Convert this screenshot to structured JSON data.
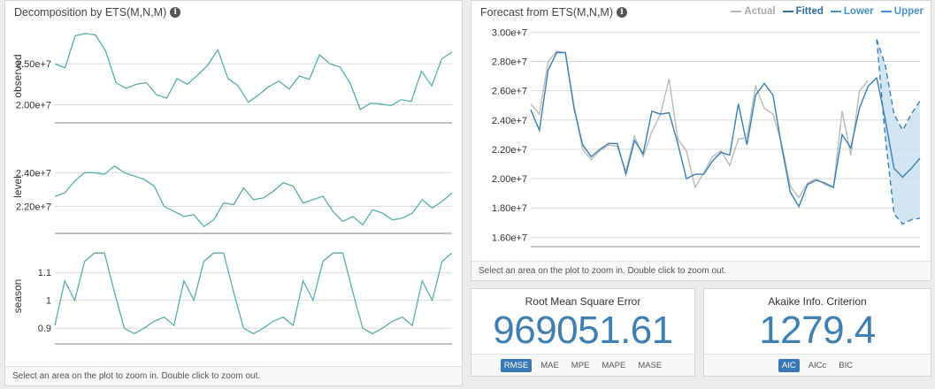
{
  "left_panel": {
    "title": "Decomposition by ETS(M,N,M)",
    "hint": "Select an area on the plot to zoom in. Double click to zoom out."
  },
  "right_panel": {
    "title": "Forecast from ETS(M,N,M)",
    "hint": "Select an area on the plot to zoom in. Double click to zoom out."
  },
  "rmse_card": {
    "title": "Root Mean Square Error",
    "value": "969051.61",
    "tabs": [
      {
        "label": "RMSE",
        "active": true
      },
      {
        "label": "MAE",
        "active": false
      },
      {
        "label": "MPE",
        "active": false
      },
      {
        "label": "MAPE",
        "active": false
      },
      {
        "label": "MASE",
        "active": false
      }
    ]
  },
  "aic_card": {
    "title": "Akaike Info. Criterion",
    "value": "1279.4",
    "tabs": [
      {
        "label": "AIC",
        "active": true
      },
      {
        "label": "AICc",
        "active": false
      },
      {
        "label": "BIC",
        "active": false
      }
    ]
  },
  "colors": {
    "teal": "#5aaea9",
    "actual": "#bbbbbb",
    "fitted": "#3a7fb5",
    "band": "#c5dff0",
    "bound": "#3a7fb5"
  },
  "chart_data": [
    {
      "type": "line",
      "title": "Decomposition by ETS(M,N,M)",
      "ylabel": "observed",
      "ytick_labels": [
        "2.50e+7",
        "2.00e+7"
      ],
      "ytick_values": [
        25000000,
        20000000
      ],
      "ylim": [
        18000000,
        29000000
      ],
      "x": [
        1,
        2,
        3,
        4,
        5,
        6,
        7,
        8,
        9,
        10,
        11,
        12,
        13,
        14,
        15,
        16,
        17,
        18,
        19,
        20,
        21,
        22,
        23,
        24,
        25,
        26,
        27,
        28,
        29,
        30,
        31,
        32,
        33,
        34,
        35,
        36,
        37,
        38,
        39,
        40,
        41,
        42,
        43,
        44,
        45,
        46,
        47,
        48
      ],
      "values": [
        25000000,
        24500000,
        28400000,
        28700000,
        28500000,
        26500000,
        22700000,
        22000000,
        22500000,
        22700000,
        21200000,
        20800000,
        23200000,
        22500000,
        23600000,
        24800000,
        26700000,
        23200000,
        22300000,
        20300000,
        21200000,
        22200000,
        22900000,
        21900000,
        23500000,
        23100000,
        26100000,
        25000000,
        24600000,
        22600000,
        19400000,
        20200000,
        20100000,
        19900000,
        20600000,
        20400000,
        24100000,
        22300000,
        25600000,
        26400000
      ]
    },
    {
      "type": "line",
      "ylabel": "level",
      "ytick_labels": [
        "2.40e+7",
        "2.20e+7"
      ],
      "ytick_values": [
        24000000,
        22000000
      ],
      "ylim": [
        20500000,
        25800000
      ],
      "values": [
        22600000,
        22800000,
        23500000,
        24000000,
        24000000,
        23900000,
        24400000,
        24000000,
        23800000,
        23600000,
        23200000,
        22000000,
        21700000,
        21400000,
        21500000,
        20800000,
        21200000,
        22200000,
        22100000,
        23100000,
        22400000,
        22500000,
        22900000,
        23400000,
        23200000,
        22200000,
        22400000,
        22600000,
        21700000,
        21100000,
        21400000,
        20900000,
        21800000,
        21600000,
        21200000,
        21300000,
        21600000,
        22400000,
        21900000,
        22300000,
        22800000
      ]
    },
    {
      "type": "line",
      "ylabel": "season",
      "ytick_labels": [
        "1.1",
        "1",
        "0.9"
      ],
      "ytick_values": [
        1.1,
        1.0,
        0.9
      ],
      "ylim": [
        0.85,
        1.18
      ],
      "values": [
        0.91,
        1.07,
        1.0,
        1.14,
        1.17,
        1.17,
        1.03,
        0.9,
        0.88,
        0.9,
        0.925,
        0.94,
        0.91,
        1.07,
        1.0,
        1.14,
        1.17,
        1.17,
        1.03,
        0.9,
        0.88,
        0.9,
        0.925,
        0.94,
        0.91,
        1.07,
        1.0,
        1.14,
        1.17,
        1.17,
        1.03,
        0.9,
        0.88,
        0.9,
        0.925,
        0.94,
        0.91,
        1.07,
        1.0,
        1.14,
        1.17
      ]
    },
    {
      "type": "line",
      "title": "Forecast from ETS(M,N,M)",
      "ytick_labels": [
        "3.00e+7",
        "2.80e+7",
        "2.60e+7",
        "2.40e+7",
        "2.20e+7",
        "2.00e+7",
        "1.80e+7",
        "1.60e+7"
      ],
      "ytick_values": [
        30000000,
        28000000,
        26000000,
        24000000,
        22000000,
        20000000,
        18000000,
        16000000
      ],
      "ylim": [
        15600000,
        30200000
      ],
      "legend": [
        "Actual",
        "Fitted",
        "Lower",
        "Upper"
      ],
      "legend_position": "top-right",
      "series": [
        {
          "name": "Actual",
          "values": [
            25100000,
            24400000,
            28000000,
            28700000,
            28600000,
            25000000,
            22000000,
            21300000,
            21900000,
            22300000,
            22200000,
            20500000,
            22900000,
            21500000,
            23200000,
            24400000,
            26800000,
            22700000,
            21900000,
            19400000,
            20400000,
            21500000,
            21900000,
            20900000,
            22700000,
            22800000,
            26300000,
            24800000,
            24400000,
            22400000,
            19500000,
            18700000,
            19700000,
            20000000,
            19600000,
            19400000,
            24600000,
            21600000,
            26000000,
            26700000
          ]
        },
        {
          "name": "Fitted",
          "values": [
            24700000,
            23300000,
            27400000,
            28600000,
            28600000,
            24800000,
            22300000,
            21500000,
            22000000,
            22400000,
            22400000,
            20300000,
            22600000,
            21700000,
            24600000,
            24400000,
            24500000,
            22400000,
            20000000,
            20300000,
            20300000,
            21200000,
            21800000,
            21600000,
            25100000,
            22300000,
            25700000,
            26500000,
            25700000,
            22200000,
            19100000,
            18100000,
            19600000,
            19900000,
            19700000,
            19400000,
            23000000,
            22100000,
            24800000,
            26300000,
            26900000
          ]
        },
        {
          "name": "Forecast",
          "values": [
            26900000,
            24000000,
            20700000,
            20100000,
            20700000,
            21400000
          ]
        },
        {
          "name": "Lower",
          "values": [
            29500000,
            22800000,
            17600000,
            16900000,
            17200000,
            17300000
          ]
        },
        {
          "name": "Upper",
          "values": [
            29500000,
            27700000,
            24400000,
            23300000,
            24400000,
            25300000
          ]
        }
      ]
    }
  ]
}
